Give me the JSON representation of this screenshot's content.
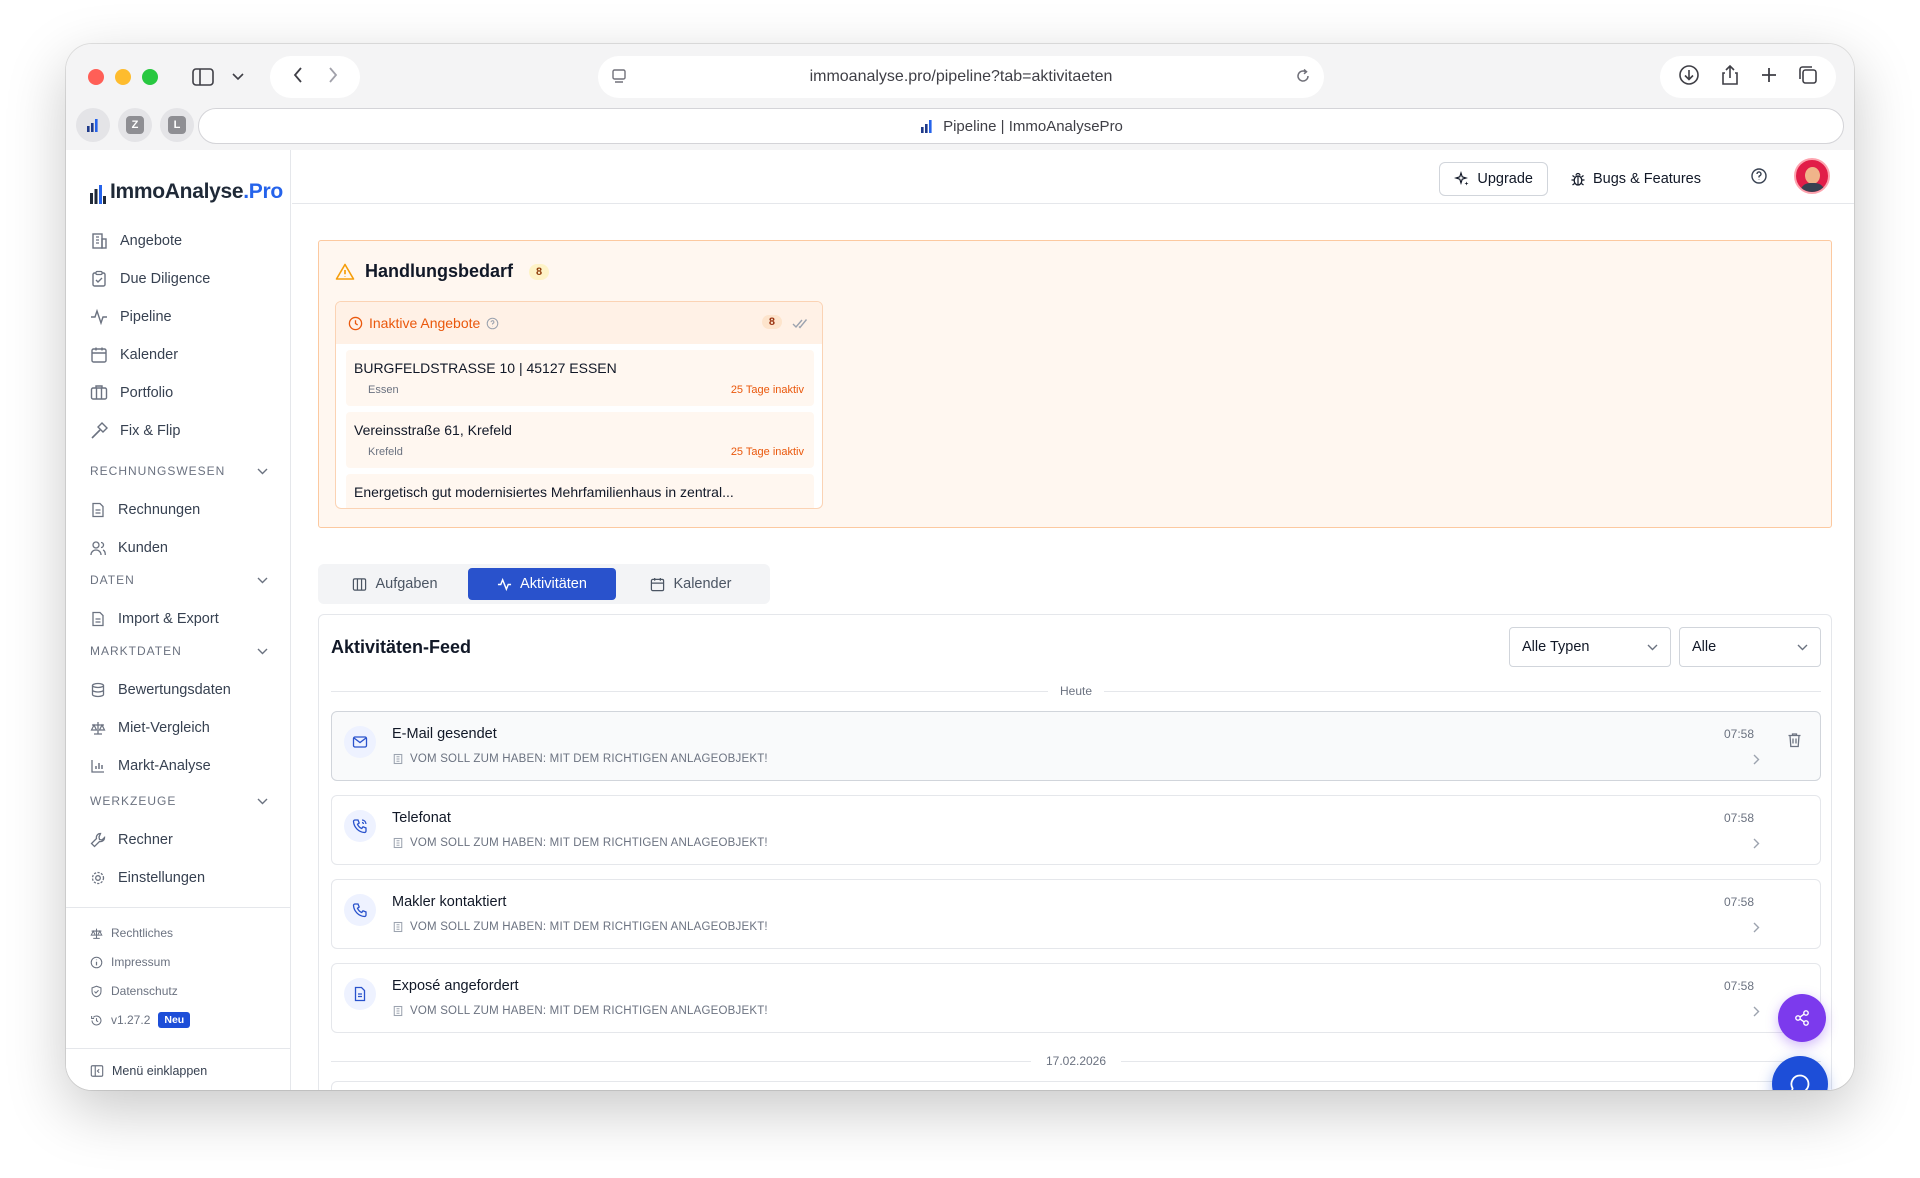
{
  "browser": {
    "url": "immoanalyse.pro/pipeline?tab=aktivitaeten",
    "tab_title": "Pipeline | ImmoAnalysePro",
    "favorites": [
      "Z",
      "L"
    ]
  },
  "brand": {
    "name_main": "ImmoAnalyse",
    "name_suffix": ".Pro",
    "accent": "#2563eb"
  },
  "sidebar": {
    "main_items": [
      {
        "label": "Angebote",
        "icon": "building-icon"
      },
      {
        "label": "Due Diligence",
        "icon": "clipboard-check-icon"
      },
      {
        "label": "Pipeline",
        "icon": "activity-icon"
      },
      {
        "label": "Kalender",
        "icon": "calendar-icon"
      },
      {
        "label": "Portfolio",
        "icon": "columns-icon"
      },
      {
        "label": "Fix & Flip",
        "icon": "hammer-icon"
      }
    ],
    "sections": [
      {
        "title": "RECHNUNGSWESEN",
        "items": [
          "Rechnungen",
          "Kunden"
        ]
      },
      {
        "title": "DATEN",
        "items": [
          "Import & Export"
        ]
      },
      {
        "title": "MARKTDATEN",
        "items": [
          "Bewertungsdaten",
          "Miet-Vergleich",
          "Markt-Analyse"
        ]
      },
      {
        "title": "WERKZEUGE",
        "items": [
          "Rechner",
          "Einstellungen"
        ]
      }
    ],
    "footer": {
      "legal": "Rechtliches",
      "imprint": "Impressum",
      "privacy": "Datenschutz",
      "version": "v1.27.2",
      "version_badge": "Neu",
      "collapse": "Menü einklappen"
    }
  },
  "topbar": {
    "upgrade": "Upgrade",
    "bugs": "Bugs & Features"
  },
  "alert": {
    "title": "Handlungsbedarf",
    "count": "8",
    "inactive": {
      "title": "Inaktive Angebote",
      "count": "8",
      "items": [
        {
          "address": "BURGFELDSTRASSE 10 | 45127 ESSEN",
          "city": "Essen",
          "age": "25 Tage inaktiv"
        },
        {
          "address": "Vereinsstraße 61, Krefeld",
          "city": "Krefeld",
          "age": "25 Tage inaktiv"
        },
        {
          "address": "Energetisch gut modernisiertes Mehrfamilienhaus in zentral..."
        }
      ]
    }
  },
  "tabs": [
    {
      "label": "Aufgaben",
      "active": false
    },
    {
      "label": "Aktivitäten",
      "active": true
    },
    {
      "label": "Kalender",
      "active": false
    }
  ],
  "feed": {
    "title": "Aktivitäten-Feed",
    "filter_type": "Alle Typen",
    "filter_scope": "Alle",
    "date_today": "Heute",
    "date_previous": "17.02.2026",
    "activities": [
      {
        "title": "E-Mail gesendet",
        "subtitle": "VOM SOLL ZUM HABEN: MIT DEM RICHTIGEN ANLAGEOBJEKT!",
        "time": "07:58",
        "icon": "mail-icon"
      },
      {
        "title": "Telefonat",
        "subtitle": "VOM SOLL ZUM HABEN: MIT DEM RICHTIGEN ANLAGEOBJEKT!",
        "time": "07:58",
        "icon": "phone-call-icon"
      },
      {
        "title": "Makler kontaktiert",
        "subtitle": "VOM SOLL ZUM HABEN: MIT DEM RICHTIGEN ANLAGEOBJEKT!",
        "time": "07:58",
        "icon": "phone-icon"
      },
      {
        "title": "Exposé angefordert",
        "subtitle": "VOM SOLL ZUM HABEN: MIT DEM RICHTIGEN ANLAGEOBJEKT!",
        "time": "07:58",
        "icon": "document-icon"
      }
    ]
  },
  "colors": {
    "primary": "#2952cc",
    "warning_bg": "#fff7f0",
    "warning_border": "#fcc9a0",
    "warning_text": "#ea580c",
    "fab_share": "#7c3aed",
    "fab_chat": "#1d4ed8"
  }
}
